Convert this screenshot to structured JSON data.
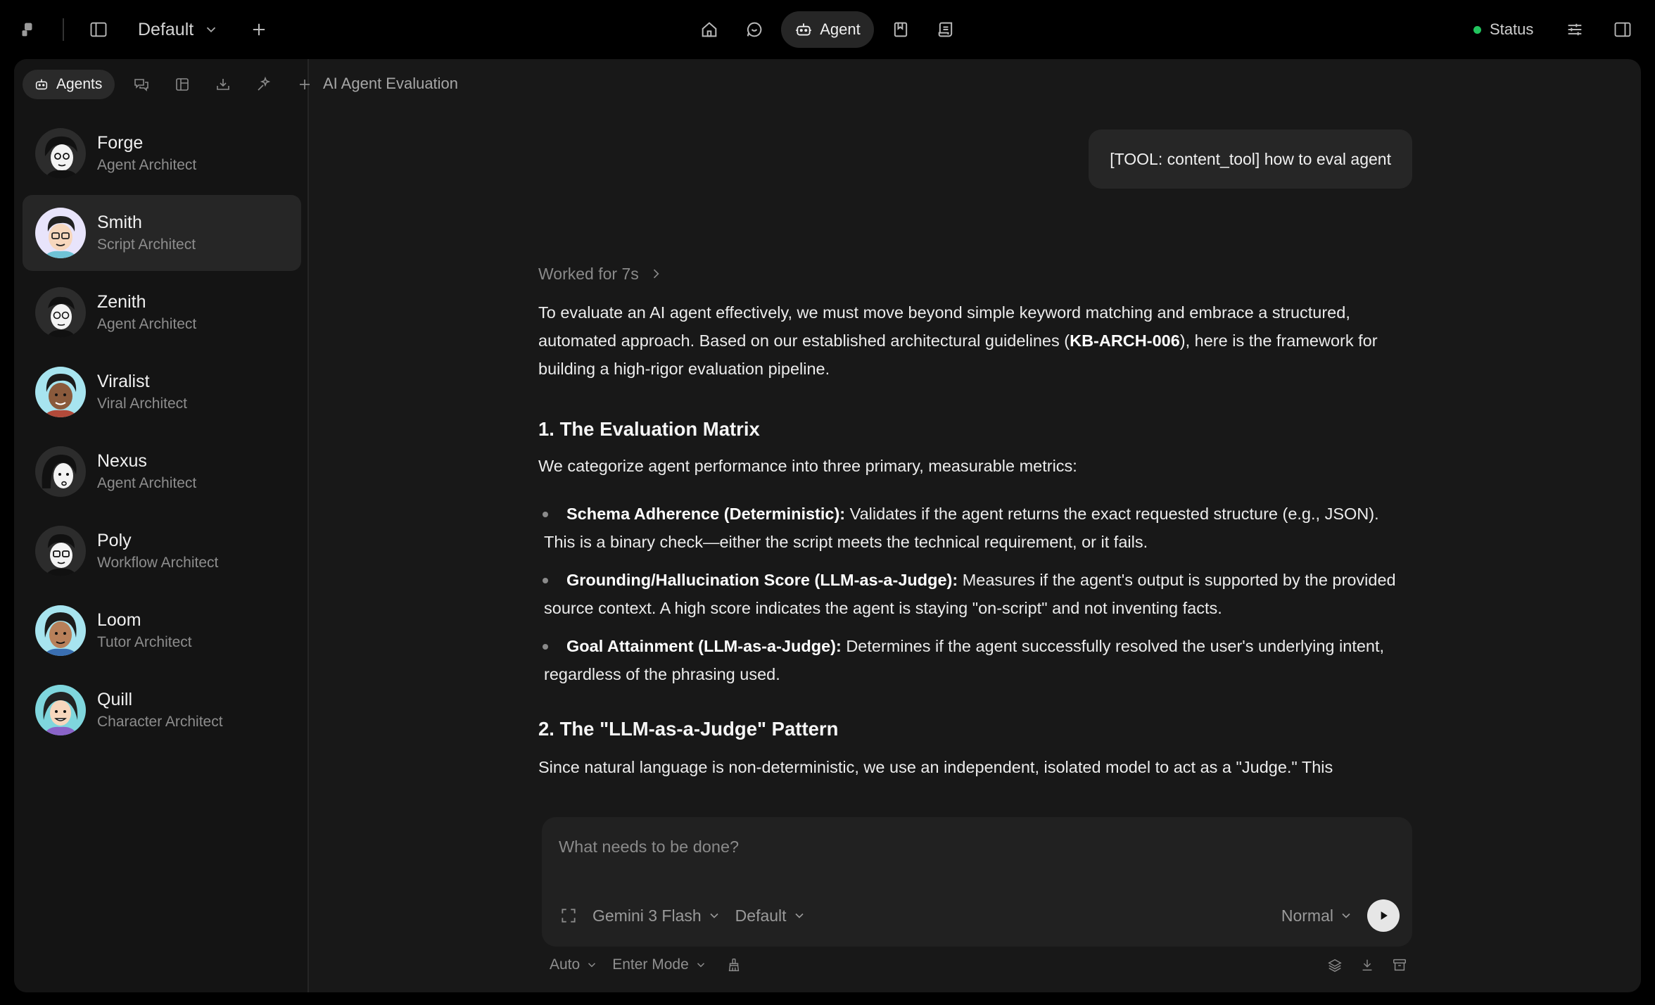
{
  "topbar": {
    "workspace": "Default",
    "agent_label": "Agent",
    "status_label": "Status",
    "status_color": "#22c55e"
  },
  "sidebar": {
    "tab_label": "Agents",
    "agents": [
      {
        "name": "Forge",
        "role": "Agent Architect"
      },
      {
        "name": "Smith",
        "role": "Script Architect"
      },
      {
        "name": "Zenith",
        "role": "Agent Architect"
      },
      {
        "name": "Viralist",
        "role": "Viral Architect"
      },
      {
        "name": "Nexus",
        "role": "Agent Architect"
      },
      {
        "name": "Poly",
        "role": "Workflow Architect"
      },
      {
        "name": "Loom",
        "role": "Tutor Architect"
      },
      {
        "name": "Quill",
        "role": "Character Architect"
      }
    ]
  },
  "conversation": {
    "title": "AI Agent Evaluation",
    "user_message": "[TOOL: content_tool] how to eval agent",
    "worked_for": "Worked for 7s",
    "intro_a": "To evaluate an AI agent effectively, we must move beyond simple keyword matching and embrace a structured, automated approach. Based on our established architectural guidelines (",
    "intro_bold": "KB-ARCH-006",
    "intro_b": "), here is the framework for building a high-rigor evaluation pipeline.",
    "section1_title": "1. The Evaluation Matrix",
    "section1_lead": "We categorize agent performance into three primary, measurable metrics:",
    "metrics": [
      {
        "label": "Schema Adherence (Deterministic):",
        "text": " Validates if the agent returns the exact requested structure (e.g., JSON). This is a binary check—either the script meets the technical requirement, or it fails."
      },
      {
        "label": "Grounding/Hallucination Score (LLM-as-a-Judge):",
        "text": " Measures if the agent's output is supported by the provided source context. A high score indicates the agent is staying \"on-script\" and not inventing facts."
      },
      {
        "label": "Goal Attainment (LLM-as-a-Judge):",
        "text": " Determines if the agent successfully resolved the user's underlying intent, regardless of the phrasing used."
      }
    ],
    "section2_title": "2. The \"LLM-as-a-Judge\" Pattern",
    "section2_lead": "Since natural language is non-deterministic, we use an independent, isolated model to act as a \"Judge.\" This"
  },
  "composer": {
    "placeholder": "What needs to be done?",
    "model": "Gemini 3 Flash",
    "profile": "Default",
    "mode": "Normal"
  },
  "footer": {
    "auto": "Auto",
    "enter_mode": "Enter Mode"
  }
}
